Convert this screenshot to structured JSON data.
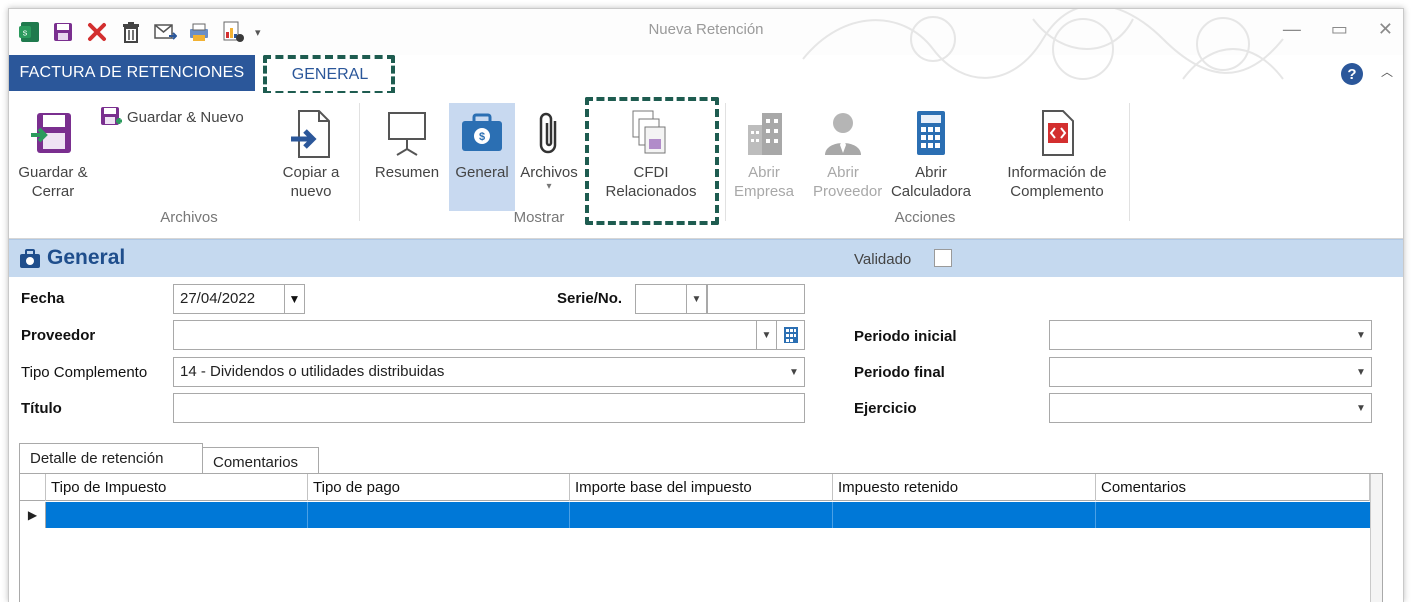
{
  "window": {
    "title": "Nueva Retención",
    "controls": {
      "minimize": "—",
      "maximize": "▭",
      "close": "✕"
    }
  },
  "quick_access": [
    "app-icon",
    "save-icon",
    "delete-icon",
    "trash-icon",
    "email-icon",
    "attach-print-icon",
    "report-icon",
    "dropdown-arrow"
  ],
  "ribbon_tabs": {
    "file_label": "FACTURA DE RETENCIONES",
    "general_label": "GENERAL"
  },
  "ribbon": {
    "archivos": {
      "label": "Archivos",
      "guardar_cerrar": "Guardar & Cerrar",
      "guardar_nuevo": "Guardar & Nuevo",
      "copiar_nuevo": "Copiar a nuevo"
    },
    "mostrar": {
      "label": "Mostrar",
      "resumen": "Resumen",
      "general": "General",
      "archivos": "Archivos",
      "cfdi": "CFDI Relacionados"
    },
    "acciones": {
      "label": "Acciones",
      "abrir_empresa": "Abrir Empresa",
      "abrir_proveedor": "Abrir Proveedor",
      "abrir_calculadora": "Abrir Calculadora",
      "info_complemento": "Información de Complemento"
    }
  },
  "section": {
    "title": "General",
    "validado_label": "Validado"
  },
  "form": {
    "fecha_label": "Fecha",
    "fecha_value": "27/04/2022",
    "serie_label": "Serie/No.",
    "serie_value": "",
    "numero_value": "",
    "proveedor_label": "Proveedor",
    "proveedor_value": "",
    "tipo_complemento_label": "Tipo Complemento",
    "tipo_complemento_value": "14 - Dividendos o utilidades distribuidas",
    "titulo_label": "Título",
    "titulo_value": "",
    "periodo_inicial_label": "Periodo inicial",
    "periodo_inicial_value": "",
    "periodo_final_label": "Periodo final",
    "periodo_final_value": "",
    "ejercicio_label": "Ejercicio",
    "ejercicio_value": ""
  },
  "detail_tabs": [
    "Detalle de retención",
    "Comentarios"
  ],
  "grid": {
    "columns": [
      "Tipo de Impuesto",
      "Tipo de pago",
      "Importe base del impuesto",
      "Impuesto retenido",
      "Comentarios"
    ]
  },
  "colors": {
    "accent": "#2b579a",
    "section_bg": "#c5d9ef",
    "selected_row": "#0078d7",
    "highlight_dash": "#1e5c50"
  }
}
